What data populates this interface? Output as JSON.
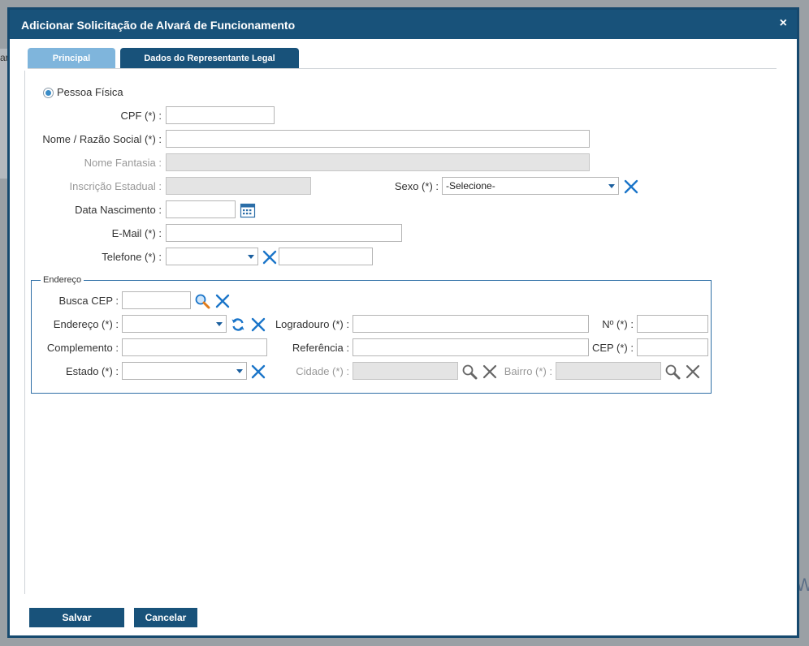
{
  "background": {
    "partial_text": "ar",
    "partial_letter": "W"
  },
  "dialog": {
    "title": "Adicionar Solicitação de Alvará de Funcionamento",
    "close_symbol": "×"
  },
  "tabs": [
    {
      "label": "Principal",
      "active": true
    },
    {
      "label": "Dados do Representante Legal",
      "active": false
    }
  ],
  "person_type": {
    "label": "Pessoa Física",
    "checked": true
  },
  "form": {
    "cpf_label": "CPF (*) :",
    "cpf_value": "",
    "nome_label": "Nome / Razão Social (*) :",
    "nome_value": "",
    "fantasia_label": "Nome Fantasia :",
    "inscricao_label": "Inscrição Estadual :",
    "sexo_label": "Sexo (*) :",
    "sexo_selected": "-Selecione-",
    "nascimento_label": "Data Nascimento :",
    "nascimento_value": "",
    "email_label": "E-Mail (*) :",
    "email_value": "",
    "telefone_label": "Telefone (*) :",
    "telefone_type_selected": "",
    "telefone_value": ""
  },
  "endereco": {
    "legend": "Endereço",
    "busca_cep_label": "Busca CEP :",
    "endereco_label": "Endereço (*) :",
    "logradouro_label": "Logradouro (*) :",
    "numero_label": "Nº (*) :",
    "complemento_label": "Complemento :",
    "referencia_label": "Referência :",
    "cep_label": "CEP (*) :",
    "estado_label": "Estado (*) :",
    "cidade_label": "Cidade (*) :",
    "bairro_label": "Bairro (*) :"
  },
  "buttons": {
    "save": "Salvar",
    "cancel": "Cancelar"
  },
  "colors": {
    "primary": "#18527a",
    "tab_active": "#7fb5dc",
    "icon_blue": "#1b75c9",
    "icon_orange": "#e07b1a",
    "icon_gray": "#666666"
  },
  "icons": {
    "clear": "x-clear-icon",
    "search": "magnifier-icon",
    "calendar": "calendar-icon",
    "refresh": "refresh-icon"
  }
}
